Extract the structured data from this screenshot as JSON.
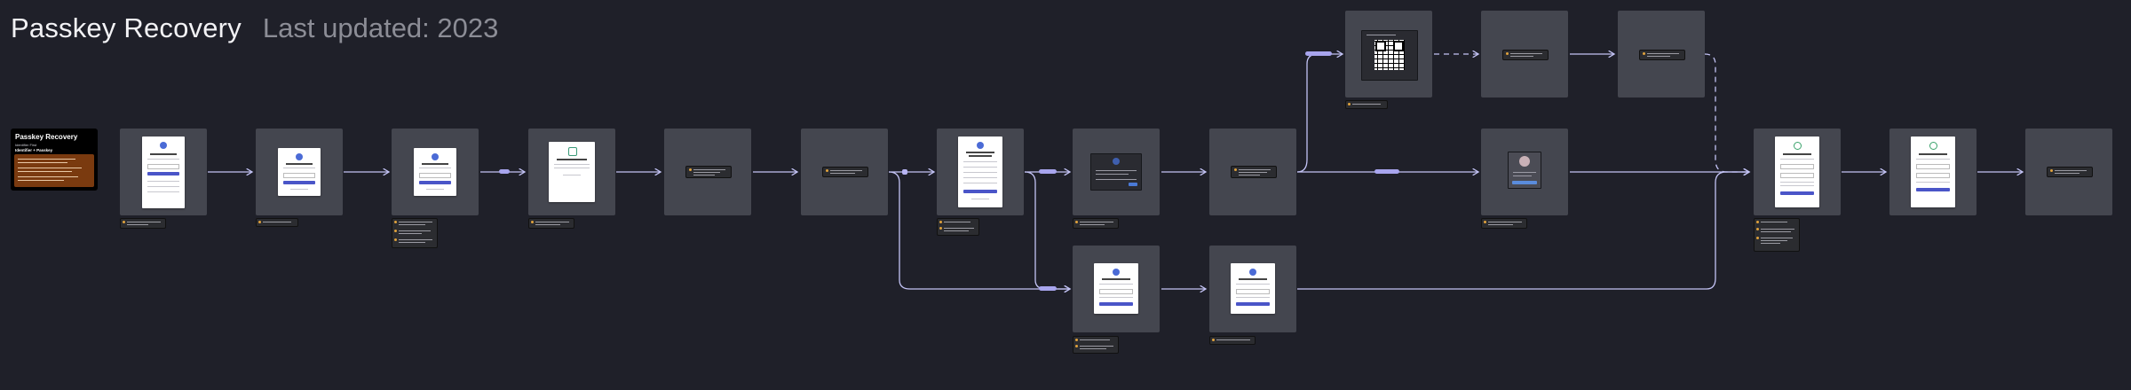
{
  "header": {
    "title": "Passkey Recovery",
    "subtitle": "Last updated: 2023"
  },
  "legend": {
    "title": "Passkey Recovery",
    "line1": "Identifier First",
    "line2": "Identifier + Passkey"
  },
  "colors": {
    "background": "#1f2029",
    "frame": "#44464f",
    "connector": "#c3c3f5",
    "pill": "#a8a5ee",
    "note_bullet": "#e0a23c",
    "primary_button": "#4a55c8",
    "legend_box": "#7a3a0f"
  },
  "flow": {
    "main_row_screens": [
      "welcome",
      "forgot-password",
      "forgot-password-email",
      "check-email",
      "email-note",
      "email-link-note",
      "create-passkey",
      "passkey-prompt",
      "passkey-note",
      "browser-passkey-dialog",
      "recovery-success",
      "recovery-success-2",
      "final-note"
    ],
    "top_row_screens": [
      "qr-code-dialog",
      "qr-note",
      "qr-note-2"
    ],
    "bottom_row_screens": [
      "create-password-1",
      "create-password-2"
    ]
  }
}
